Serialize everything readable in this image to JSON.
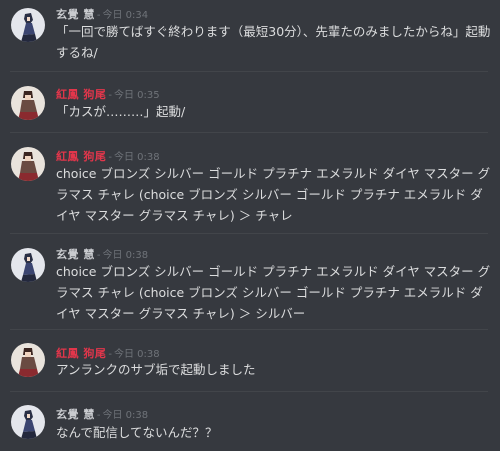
{
  "colors": {
    "background": "#36393f",
    "divider": "#42454a",
    "text": "#dcddde",
    "timestamp": "#6f7379",
    "user_genkaku": "#c9cbcf",
    "user_kouhou": "#e2364b"
  },
  "separator": "-",
  "messages": [
    {
      "username": "玄覺 慧",
      "timestamp": "今日 0:34",
      "text": "「一回で勝てばすぐ終わります（最短30分）、先輩たのみましたからね」起動するね/",
      "avatar_icon": "avatar-genkaku-icon"
    },
    {
      "username": "紅鳳 狗尾",
      "timestamp": "今日 0:35",
      "text": "「カスが………」起動/",
      "avatar_icon": "avatar-kouhou-icon"
    },
    {
      "username": "紅鳳 狗尾",
      "timestamp": "今日 0:38",
      "text": "choice ブロンズ シルバー ゴールド プラチナ エメラルド ダイヤ マスター グラマス チャレ (choice ブロンズ シルバー ゴールド プラチナ エメラルド ダイヤ マスター グラマス チャレ) ＞ チャレ",
      "avatar_icon": "avatar-kouhou-icon"
    },
    {
      "username": "玄覺 慧",
      "timestamp": "今日 0:38",
      "text": "choice ブロンズ シルバー ゴールド プラチナ エメラルド ダイヤ マスター グラマス チャレ (choice ブロンズ シルバー ゴールド プラチナ エメラルド ダイヤ マスター グラマス チャレ) ＞ シルバー",
      "avatar_icon": "avatar-genkaku-icon"
    },
    {
      "username": "紅鳳 狗尾",
      "timestamp": "今日 0:38",
      "text": "アンランクのサブ垢で起動しました",
      "avatar_icon": "avatar-kouhou-icon"
    },
    {
      "username": "玄覺 慧",
      "timestamp": "今日 0:38",
      "text": "なんで配信してないんだ？？",
      "avatar_icon": "avatar-genkaku-icon"
    }
  ]
}
